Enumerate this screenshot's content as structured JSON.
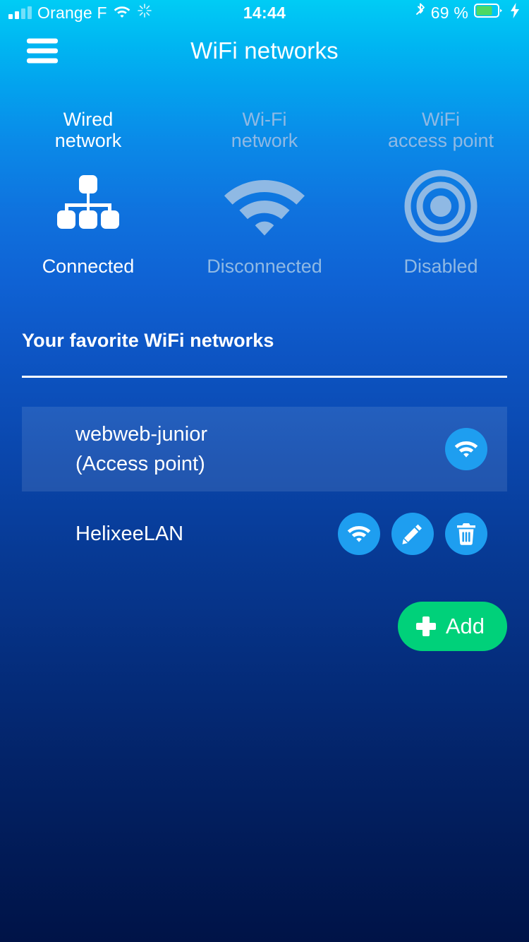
{
  "status_bar": {
    "carrier": "Orange F",
    "signal_bars_filled": 2,
    "signal_bars_total": 4,
    "wifi_icon": "wifi-icon",
    "sync_icon": "sync-spinner-icon",
    "time": "14:44",
    "bluetooth_icon": "bluetooth-icon",
    "battery_percent": "69 %",
    "battery_level": 69,
    "battery_color": "#4cd964",
    "charging_icon": "lightning-bolt-icon"
  },
  "navbar": {
    "menu_icon": "hamburger-menu-icon",
    "title": "WiFi networks"
  },
  "cards": [
    {
      "title_line1": "Wired",
      "title_line2": "network",
      "icon": "sitemap-icon",
      "status": "Connected",
      "state": "active",
      "color": "#ffffff"
    },
    {
      "title_line1": "Wi-Fi",
      "title_line2": "network",
      "icon": "wifi-icon",
      "status": "Disconnected",
      "state": "muted",
      "color": "#8fb9e4"
    },
    {
      "title_line1": "WiFi",
      "title_line2": "access point",
      "icon": "access-point-icon",
      "status": "Disabled",
      "state": "muted",
      "color": "#8fb9e4"
    }
  ],
  "section": {
    "title": "Your favorite WiFi networks"
  },
  "networks": [
    {
      "name": "webweb-junior",
      "sub": "(Access point)",
      "highlighted": true,
      "actions": [
        "wifi-icon"
      ]
    },
    {
      "name": "HelixeeLAN",
      "sub": "",
      "highlighted": false,
      "actions": [
        "wifi-icon",
        "pencil-edit-icon",
        "trash-delete-icon"
      ]
    }
  ],
  "add_button": {
    "label": "Add",
    "icon": "plus-icon",
    "color": "#00d17a"
  },
  "theme": {
    "accent_blue": "#1e9ef0",
    "muted_blue": "#8fb9e4",
    "gradient_top": "#00ccf5",
    "gradient_bottom": "#001347"
  }
}
